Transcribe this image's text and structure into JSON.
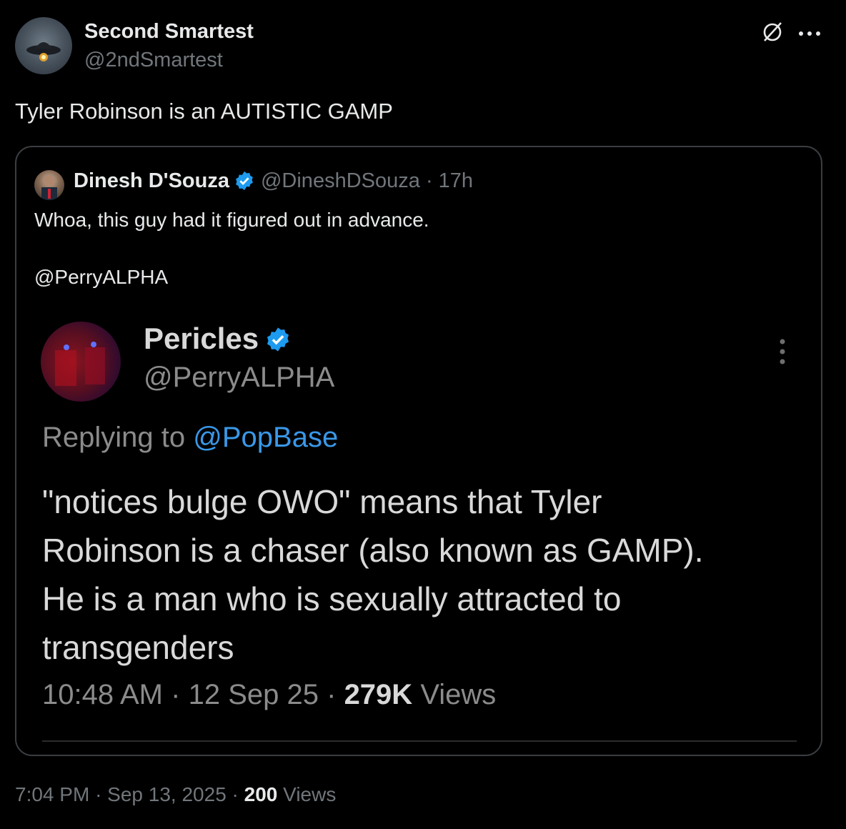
{
  "post": {
    "author_name": "Second Smartest",
    "author_handle": "@2ndSmartest",
    "text": "Tyler Robinson is an AUTISTIC GAMP",
    "time": "7:04 PM",
    "date": "Sep 13, 2025",
    "views_count": "200",
    "views_label": "Views",
    "separator": "·"
  },
  "quote": {
    "author_name": "Dinesh D'Souza",
    "author_handle": "@DineshDSouza",
    "age": "17h",
    "separator": "·",
    "line1": "Whoa, this guy had it figured out in advance.",
    "line2": "@PerryALPHA"
  },
  "embedded_tweet": {
    "author_name": "Pericles",
    "author_handle": "@PerryALPHA",
    "replying_label": "Replying to",
    "replying_to": "@PopBase",
    "body_lines": [
      "\"notices bulge OWO\" means that Tyler",
      "Robinson is a chaser (also known as GAMP).",
      "He is a man who is sexually attracted to",
      "transgenders"
    ],
    "time": "10:48 AM",
    "date": "12 Sep 25",
    "views_count": "279K",
    "views_label": "Views",
    "separator": "·"
  },
  "icons": {
    "grok": "grok-icon",
    "more": "more-horizontal-icon",
    "verified": "verified-badge-icon",
    "embedded_more": "more-vertical-icon"
  },
  "colors": {
    "background": "#000000",
    "text_primary": "#e7e9ea",
    "text_secondary": "#71767b",
    "verified_blue": "#1d9bf0",
    "mention_blue": "#3a98e8"
  }
}
